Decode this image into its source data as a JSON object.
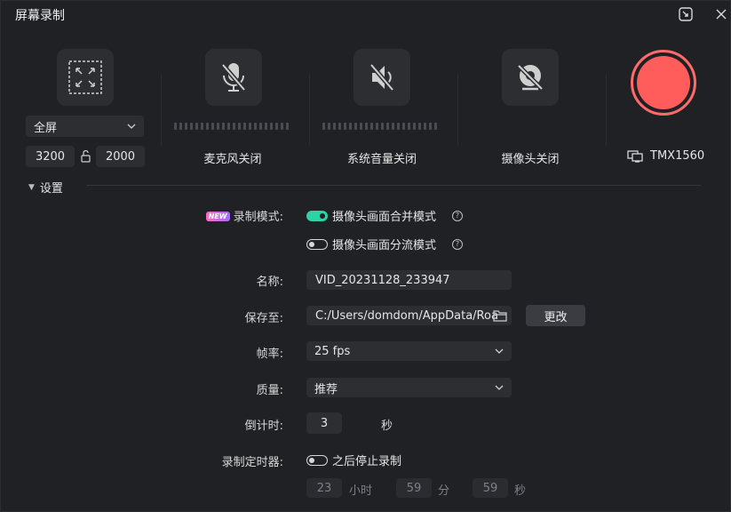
{
  "window": {
    "title": "屏幕录制"
  },
  "sources": {
    "fullscreen_select": "全屏",
    "width": "3200",
    "height": "2000",
    "mic_label": "麦克风关闭",
    "system_audio_label": "系统音量关闭",
    "camera_label": "摄像头关闭",
    "monitor_label": "TMX1560"
  },
  "settings": {
    "header": "设置",
    "record_mode_label": "录制模式:",
    "new_badge": "NEW",
    "mode_merge": "摄像头画面合并模式",
    "mode_merge_on": true,
    "mode_split": "摄像头画面分流模式",
    "mode_split_on": false,
    "help_glyph": "?",
    "name_label": "名称:",
    "name_value": "VID_20231128_233947",
    "save_label": "保存至:",
    "save_path": "C:/Users/domdom/AppData/Roa",
    "change_button": "更改",
    "fps_label": "帧率:",
    "fps_value": "25 fps",
    "quality_label": "质量:",
    "quality_value": "推荐",
    "countdown_label": "倒计时:",
    "countdown_value": "3",
    "countdown_unit": "秒",
    "timer_label": "录制定时器:",
    "timer_toggle_text": "之后停止录制",
    "timer_on": false,
    "timer_hours": "23",
    "timer_hours_unit": "小时",
    "timer_minutes": "59",
    "timer_minutes_unit": "分",
    "timer_seconds": "59",
    "timer_seconds_unit": "秒"
  },
  "colors": {
    "accent_toggle": "#2fd1a6",
    "record": "#ff5c5c",
    "background": "#1f2124"
  },
  "icons": {
    "minimize": "picture-in-picture-icon",
    "close": "close-icon",
    "screen": "fullscreen-frame-icon",
    "mic": "mic-off-icon",
    "system": "speaker-off-icon",
    "camera": "camera-off-icon",
    "monitor": "monitor-icon",
    "folder": "folder-icon",
    "lock": "aspect-lock-icon"
  }
}
